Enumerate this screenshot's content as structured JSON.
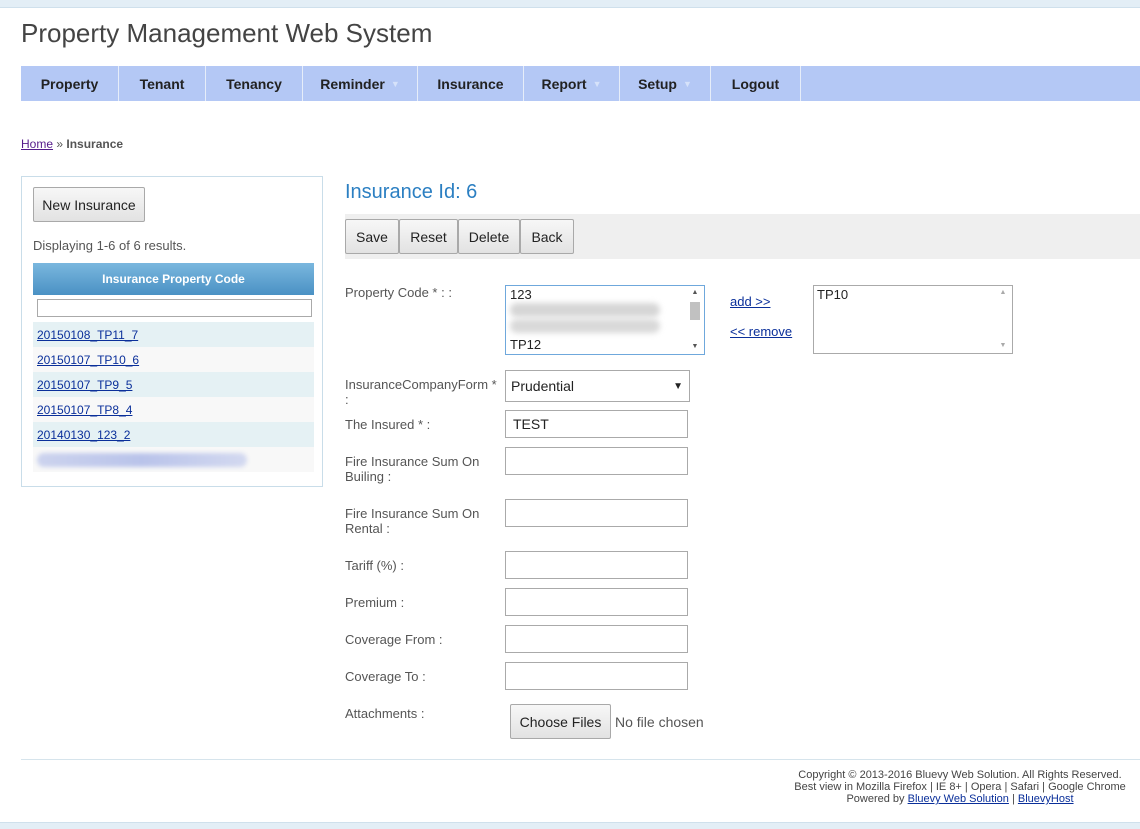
{
  "app": {
    "title": "Property Management Web System"
  },
  "menu": [
    {
      "label": "Property",
      "has_dropdown": false
    },
    {
      "label": "Tenant",
      "has_dropdown": false
    },
    {
      "label": "Tenancy",
      "has_dropdown": false
    },
    {
      "label": "Reminder",
      "has_dropdown": true
    },
    {
      "label": "Insurance",
      "has_dropdown": false
    },
    {
      "label": "Report",
      "has_dropdown": true
    },
    {
      "label": "Setup",
      "has_dropdown": true
    },
    {
      "label": "Logout",
      "has_dropdown": false
    }
  ],
  "breadcrumb": {
    "home": "Home",
    "separator": "»",
    "current": "Insurance"
  },
  "sidebar": {
    "new_button": "New Insurance",
    "summary": "Displaying 1-6 of 6 results.",
    "grid_header": "Insurance Property Code",
    "filter_value": "",
    "rows": [
      "20150108_TP11_7",
      "20150107_TP10_6",
      "20150107_TP9_5",
      "20150107_TP8_4",
      "20140130_123_2"
    ]
  },
  "page": {
    "title": "Insurance Id: 6"
  },
  "toolbar": {
    "save": "Save",
    "reset": "Reset",
    "delete": "Delete",
    "back": "Back"
  },
  "form": {
    "property_code_label": "Property Code * : :",
    "available_codes": [
      "123",
      "TP12"
    ],
    "add_link": "add >>",
    "remove_link": "<< remove",
    "selected_codes": [
      "TP10"
    ],
    "company_label": "InsuranceCompanyForm * :",
    "company_value": "Prudential",
    "insured_label": "The Insured * :",
    "insured_value": "TEST",
    "fire_building_label": "Fire Insurance Sum On Builing :",
    "fire_building_value": "",
    "fire_rental_label": "Fire Insurance Sum On Rental :",
    "fire_rental_value": "",
    "tariff_label": "Tariff (%) :",
    "tariff_value": "",
    "premium_label": "Premium :",
    "premium_value": "",
    "coverage_from_label": "Coverage From :",
    "coverage_from_value": "",
    "coverage_to_label": "Coverage To :",
    "coverage_to_value": "",
    "attachments_label": "Attachments :",
    "choose_files": "Choose Files",
    "file_status": "No file chosen"
  },
  "footer": {
    "copyright": "Copyright © 2013-2016 Bluevy Web Solution. All Rights Reserved.",
    "best_view": "Best view in Mozilla Firefox | IE 8+ | Opera | Safari | Google Chrome",
    "powered_by": "Powered by",
    "link1": "Bluevy Web Solution",
    "sep": "|",
    "link2": "BluevyHost"
  },
  "colors": {
    "menubar": "#b4c8f5",
    "title_blue": "#2b7fc2",
    "grid_header": "#5aa0cf",
    "row_alt": "#e5f1f4"
  }
}
